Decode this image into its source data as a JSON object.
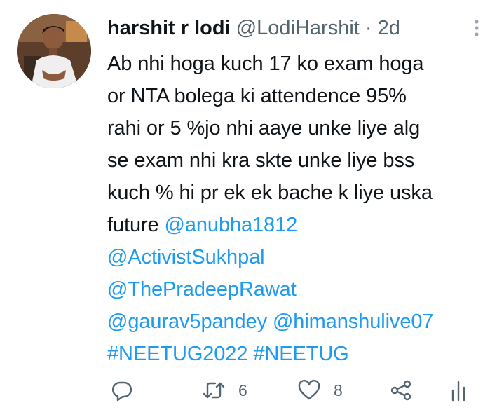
{
  "tweet": {
    "author_name": "harshit r lodi",
    "author_handle": "@LodiHarshit",
    "separator": "·",
    "timestamp": "2d",
    "lines": [
      {
        "text": "Ab nhi hoga kuch 17 ko exam hoga"
      },
      {
        "text": "or NTA bolega ki attendence 95%"
      },
      {
        "text": "rahi or 5 %jo nhi aaye unke liye alg"
      },
      {
        "text": "se exam nhi kra skte unke liye bss"
      },
      {
        "text": "kuch % hi pr ek ek bache k liye uska"
      },
      {
        "text": "future ",
        "mention": "@anubha1812"
      },
      {
        "mention": "@ActivistSukhpal"
      },
      {
        "mention": "@ThePradeepRawat"
      },
      {
        "mention": "@gaurav5pandey",
        "mention2": "@himanshulive07"
      },
      {
        "hashtag": "#NEETUG2022",
        "hashtag2": "#NEETUG"
      }
    ]
  },
  "actions": {
    "reply": {
      "icon": "reply-icon",
      "count": ""
    },
    "retweet": {
      "icon": "retweet-icon",
      "count": "6"
    },
    "like": {
      "icon": "heart-icon",
      "count": "8"
    },
    "share": {
      "icon": "share-icon"
    },
    "analytics": {
      "icon": "analytics-icon"
    }
  },
  "colors": {
    "link": "#1d9bf0",
    "secondary_text": "#536471",
    "primary_text": "#0f1419"
  }
}
